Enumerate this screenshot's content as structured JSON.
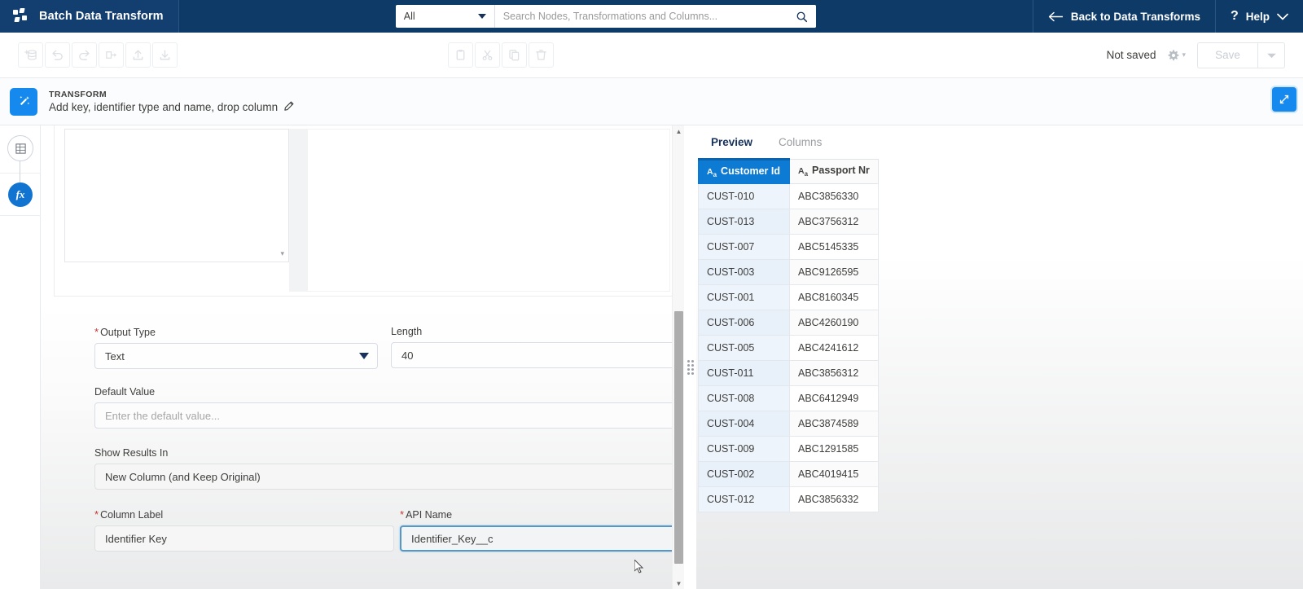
{
  "topnav": {
    "brand": "Batch Data Transform",
    "brand_logo_icon": "batch-transform-logo-icon",
    "search": {
      "scope": "All",
      "scope_caret_icon": "chevron-down-icon",
      "placeholder": "Search Nodes, Transformations and Columns...",
      "value": "",
      "search_icon": "search-icon"
    },
    "back": {
      "label": "Back to Data Transforms",
      "icon": "arrow-left-icon"
    },
    "help": {
      "label": "Help",
      "icon": "question-mark-icon",
      "caret_icon": "chevron-down-icon"
    }
  },
  "toolbar": {
    "left_buttons": [
      {
        "name": "add-data-source-button",
        "icon": "add-database-icon"
      },
      {
        "name": "undo-button",
        "icon": "undo-icon"
      },
      {
        "name": "redo-button",
        "icon": "redo-icon"
      },
      {
        "name": "branch-button",
        "icon": "branch-icon"
      },
      {
        "name": "upload-button",
        "icon": "upload-icon"
      },
      {
        "name": "download-button",
        "icon": "download-icon"
      }
    ],
    "mid_buttons": [
      {
        "name": "paste-button",
        "icon": "clipboard-icon"
      },
      {
        "name": "cut-button",
        "icon": "scissors-icon"
      },
      {
        "name": "copy-button",
        "icon": "copy-icon"
      },
      {
        "name": "delete-button",
        "icon": "trash-icon"
      }
    ],
    "status": "Not saved",
    "gear_icon": "gear-icon",
    "gear_caret_icon": "chevron-down-icon",
    "save_label": "Save",
    "save_caret_icon": "chevron-down-icon"
  },
  "transform_header": {
    "icon": "magic-wand-transform-icon",
    "kicker": "TRANSFORM",
    "name": "Add key, identifier type and name, drop column",
    "edit_icon": "pencil-icon",
    "expand_icon": "expand-diagonal-icon"
  },
  "rail": {
    "node_icon": "data-node-icon",
    "formula_icon": "fx-formula-icon"
  },
  "form": {
    "output_type": {
      "label": "Output Type",
      "required": true,
      "value": "Text",
      "caret_icon": "chevron-down-icon"
    },
    "length": {
      "label": "Length",
      "required": false,
      "value": "40"
    },
    "default_value": {
      "label": "Default Value",
      "required": false,
      "value": "",
      "placeholder": "Enter the default value..."
    },
    "show_results_in": {
      "label": "Show Results In",
      "required": false,
      "value": "New Column (and Keep Original)",
      "caret_icon": "chevron-down-icon"
    },
    "column_label": {
      "label": "Column Label",
      "required": true,
      "value": "Identifier Key"
    },
    "api_name": {
      "label": "API Name",
      "required": true,
      "value": "Identifier_Key__c",
      "focused": true
    },
    "scroll_up_icon": "scroll-up-arrow-icon",
    "scroll_down_icon": "scroll-down-arrow-icon",
    "resize_handle_icon": "drag-grip-icon"
  },
  "preview": {
    "tabs": [
      {
        "label": "Preview",
        "active": true
      },
      {
        "label": "Columns",
        "active": false
      }
    ],
    "columns": [
      {
        "label": "Customer Id",
        "type_icon": "text-type-icon",
        "selected": true
      },
      {
        "label": "Passport Nr",
        "type_icon": "text-type-icon",
        "selected": false
      }
    ],
    "rows": [
      [
        "CUST-010",
        "ABC3856330"
      ],
      [
        "CUST-013",
        "ABC3756312"
      ],
      [
        "CUST-007",
        "ABC5145335"
      ],
      [
        "CUST-003",
        "ABC9126595"
      ],
      [
        "CUST-001",
        "ABC8160345"
      ],
      [
        "CUST-006",
        "ABC4260190"
      ],
      [
        "CUST-005",
        "ABC4241612"
      ],
      [
        "CUST-011",
        "ABC3856312"
      ],
      [
        "CUST-008",
        "ABC6412949"
      ],
      [
        "CUST-004",
        "ABC3874589"
      ],
      [
        "CUST-009",
        "ABC1291585"
      ],
      [
        "CUST-002",
        "ABC4019415"
      ],
      [
        "CUST-012",
        "ABC3856332"
      ]
    ]
  },
  "colors": {
    "nav_background": "#0e3a68",
    "accent_blue": "#1589ee",
    "selected_header_blue": "#0d7bd4",
    "required_red": "#c23934",
    "focus_border": "#5598c6"
  }
}
